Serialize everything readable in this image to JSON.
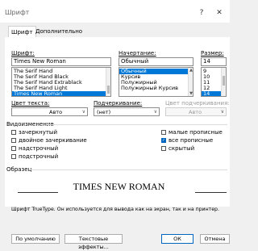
{
  "window": {
    "title": "Шрифт",
    "help_glyph": "?",
    "close_glyph": "✕"
  },
  "tabs": [
    {
      "label": "Шрифт"
    },
    {
      "label": "Дополнительно"
    }
  ],
  "font": {
    "label": "Шрифт:",
    "value": "Times New Roman",
    "items": [
      "The Serif Hand",
      "The Serif Hand Black",
      "The Serif Hand Extrablack",
      "The Serif Hand Light",
      "Times New Roman"
    ],
    "selected_index": 4
  },
  "style": {
    "label": "Начертание:",
    "value": "Обычный",
    "items": [
      "Обычный",
      "Курсив",
      "Полужирный",
      "Полужирный Курсив"
    ],
    "selected_index": 0
  },
  "size": {
    "label": "Размер:",
    "value": "14",
    "items": [
      "9",
      "10",
      "11",
      "12",
      "14"
    ],
    "selected_index": 4
  },
  "text_color": {
    "label": "Цвет текста:",
    "value": "Авто"
  },
  "underline": {
    "label": "Подчеркивание:",
    "value": "(нет)"
  },
  "underline_color": {
    "label": "Цвет подчеркивания:",
    "value": "Авто",
    "disabled": true
  },
  "effects": {
    "group_label": "Видоизменение",
    "items": [
      {
        "label": "зачеркнутый",
        "checked": false
      },
      {
        "label": "двойное зачеркивание",
        "checked": false
      },
      {
        "label": "надстрочный",
        "checked": false
      },
      {
        "label": "подстрочный",
        "checked": false
      },
      {
        "label": "малые прописные",
        "checked": false
      },
      {
        "label": "все прописные",
        "checked": true
      },
      {
        "label": "скрытый",
        "checked": false
      }
    ]
  },
  "preview": {
    "group_label": "Образец",
    "text": "TIMES NEW ROMAN",
    "note": "Шрифт TrueType. Он используется для вывода как на экран, так и на принтер."
  },
  "buttons": {
    "default": "По умолчанию",
    "text_effects": "Текстовые эффекты...",
    "ok": "ОК",
    "cancel": "Отмена"
  },
  "check_glyph": "✓",
  "dropdown_glyph": "∨",
  "colors": {
    "accent": "#0078d7",
    "checkbox_accent": "#0067c0"
  }
}
